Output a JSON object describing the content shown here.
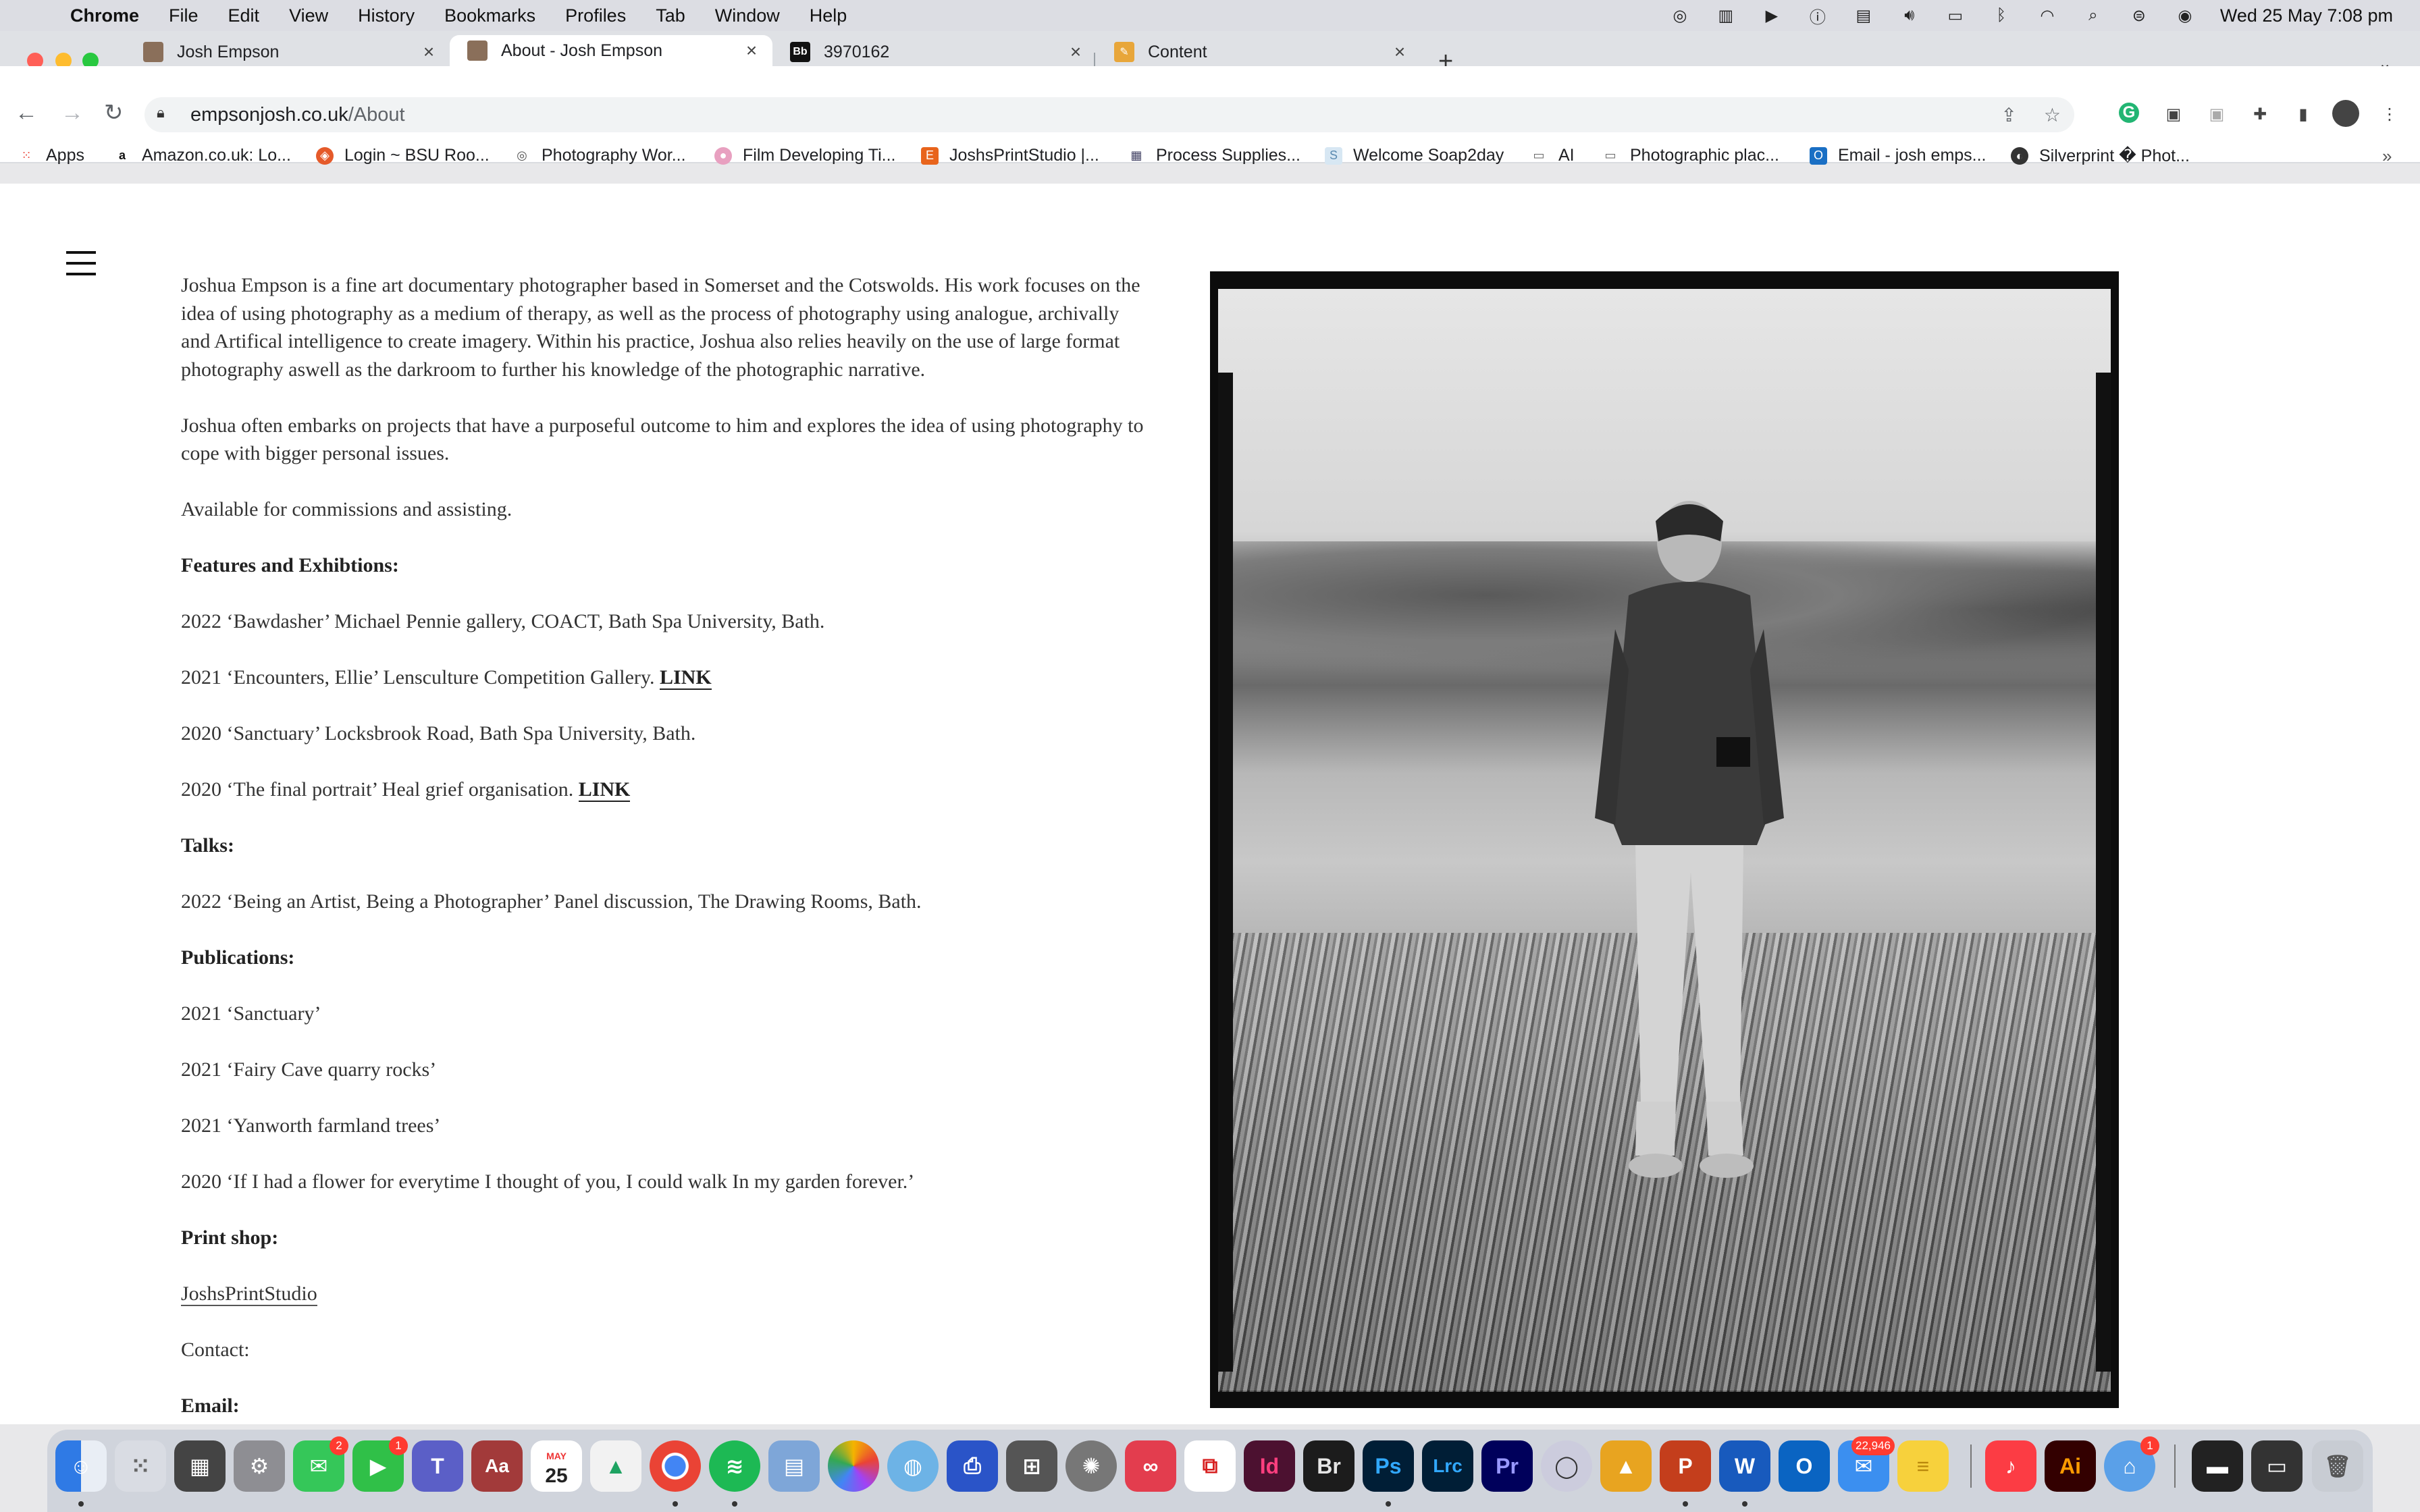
{
  "menubar": {
    "items": [
      "Chrome",
      "File",
      "Edit",
      "View",
      "History",
      "Bookmarks",
      "Profiles",
      "Tab",
      "Window",
      "Help"
    ],
    "clock": "Wed 25 May  7:08 pm"
  },
  "tabs": [
    {
      "title": "Josh Empson",
      "favicon": "site-portrait-icon"
    },
    {
      "title": "About - Josh Empson",
      "favicon": "site-portrait-icon",
      "active": true
    },
    {
      "title": "3970162",
      "favicon": "behance-icon"
    },
    {
      "title": "Content",
      "favicon": "edit-icon"
    }
  ],
  "address": {
    "domain": "empsonjosh.co.uk",
    "path": "/About"
  },
  "bookmarks": [
    {
      "label": "Apps",
      "icon": "apps-grid-icon"
    },
    {
      "label": "Amazon.co.uk: Lo...",
      "icon": "amazon-icon"
    },
    {
      "label": "Login ~ BSU Roo...",
      "icon": "bsu-icon"
    },
    {
      "label": "Photography Wor...",
      "icon": "camera-icon"
    },
    {
      "label": "Film Developing Ti...",
      "icon": "film-icon"
    },
    {
      "label": "JoshsPrintStudio |...",
      "icon": "etsy-icon"
    },
    {
      "label": "Process Supplies...",
      "icon": "process-icon"
    },
    {
      "label": "Welcome Soap2day",
      "icon": "soap-icon"
    },
    {
      "label": "AI",
      "icon": "folder-icon"
    },
    {
      "label": "Photographic plac...",
      "icon": "folder-icon"
    },
    {
      "label": "Email - josh emps...",
      "icon": "outlook-icon"
    },
    {
      "label": "Silverprint � Phot...",
      "icon": "silverprint-icon"
    }
  ],
  "about": {
    "intro": "Joshua Empson is a fine art documentary photographer based in Somerset and the Cotswolds. His work focuses on the idea of using photography as a medium of therapy, as well as the process of photography using analogue, archivally and Artifical intelligence to create imagery. Within his practice, Joshua also relies heavily on the use of large format photography aswell as the darkroom to further his knowledge of the photographic narrative.",
    "projects": "Joshua often embarks on projects that have a purposeful outcome to him and explores the idea of using photography to cope with bigger personal issues.",
    "availability": "Available for commissions and assisting.",
    "features_heading": "Features and Exhibtions:",
    "features": [
      {
        "text": "2022 ‘Bawdasher’ Michael Pennie gallery, COACT, Bath Spa University, Bath.",
        "link": ""
      },
      {
        "text": "2021 ‘Encounters, Ellie’ Lensculture Competition Gallery. ",
        "link": "LINK"
      },
      {
        "text": "2020 ‘Sanctuary’ Locksbrook Road, Bath Spa University, Bath.",
        "link": ""
      },
      {
        "text": "2020 ‘The final portrait’ Heal grief organisation. ",
        "link": "LINK"
      }
    ],
    "talks_heading": "Talks:",
    "talks": [
      "2022 ‘Being an Artist, Being a Photographer’ Panel discussion, The Drawing Rooms, Bath."
    ],
    "publications_heading": "Publications:",
    "publications": [
      "2021 ‘Sanctuary’",
      "2021 ‘Fairy Cave quarry rocks’",
      "2021 ‘Yanworth farmland trees’",
      "2020 ‘If I had a flower for everytime I thought of you, I could walk In my garden forever.’"
    ],
    "printshop_heading": "Print shop:",
    "printshop_link": "JoshsPrintStudio",
    "contact_heading": "Contact:",
    "email_label": "Email:"
  },
  "dock": {
    "badges": {
      "messages": "2",
      "facetime": "1",
      "mail": "22,946",
      "screens": "1"
    },
    "calendar_month": "MAY",
    "calendar_day": "25"
  }
}
